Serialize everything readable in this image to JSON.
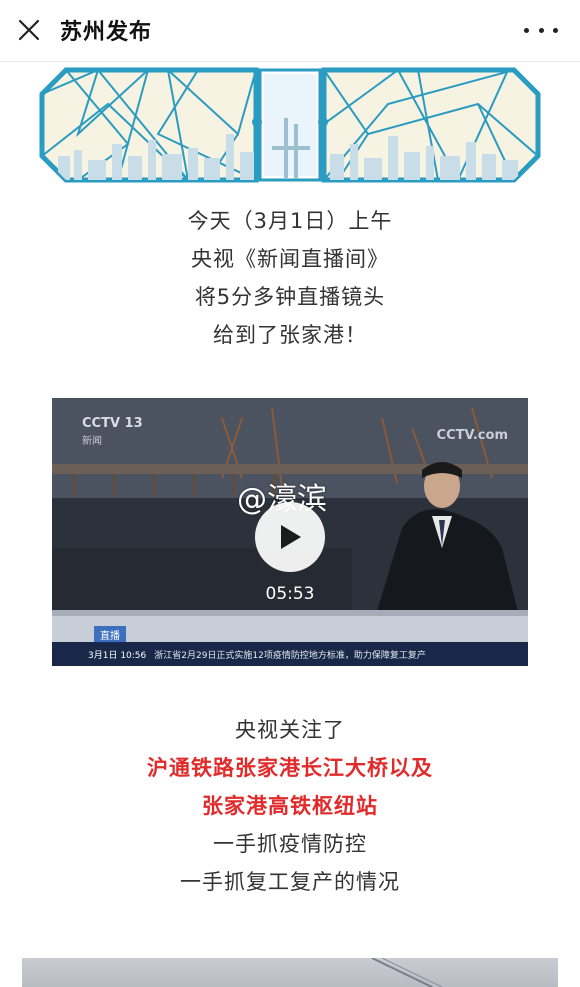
{
  "topbar": {
    "title": "苏州发布"
  },
  "intro": [
    "今天（3月1日）上午",
    "央视《新闻直播间》",
    "将5分多钟直播镜头",
    "给到了张家港！"
  ],
  "video": {
    "channel_logo": "CCTV 13",
    "channel_sub": "新闻",
    "corner_logo": "CCTV.com",
    "watermark": "@濠滨",
    "duration": "05:53",
    "ticker_tag": "直播",
    "ticker_date": "3月1日  10:56",
    "ticker_text": "浙江省2月29日正式实施12项疫情防控地方标准，助力保障复工复产"
  },
  "focus": [
    {
      "text": "央视关注了",
      "highlight": false
    },
    {
      "text": "沪通铁路张家港长江大桥以及",
      "highlight": true
    },
    {
      "text": "张家港高铁枢纽站",
      "highlight": true
    },
    {
      "text": "一手抓疫情防控",
      "highlight": false
    },
    {
      "text": "一手抓复工复产的情况",
      "highlight": false
    }
  ],
  "colors": {
    "highlight": "#e12b2b",
    "banner_blue": "#2a9bc1"
  }
}
